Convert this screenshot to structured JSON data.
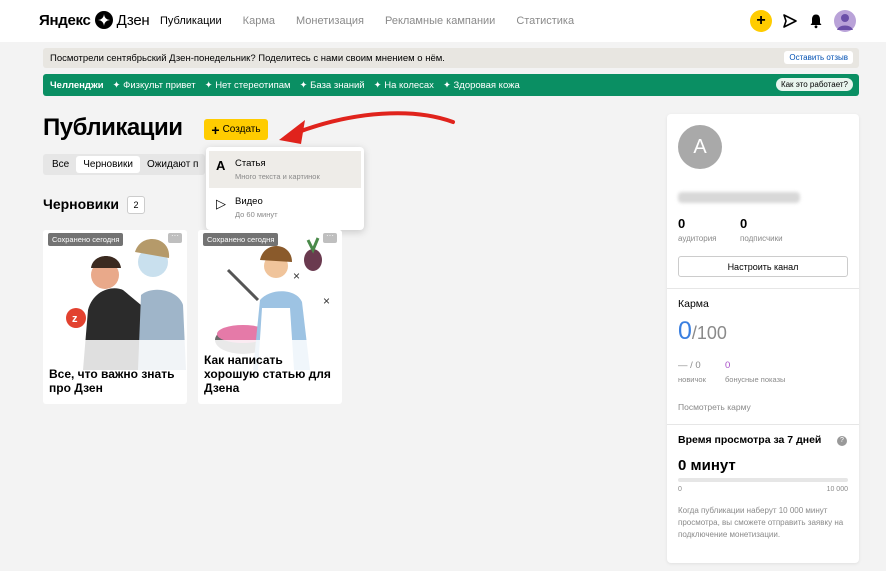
{
  "header": {
    "logo_bold": "Яндекс",
    "logo_light": "Дзен",
    "nav": [
      {
        "label": "Публикации",
        "active": true
      },
      {
        "label": "Карма",
        "active": false
      },
      {
        "label": "Монетизация",
        "active": false
      },
      {
        "label": "Рекламные кампании",
        "active": false
      },
      {
        "label": "Статистика",
        "active": false
      }
    ],
    "icons": [
      "plus-icon",
      "send-icon",
      "bell-icon",
      "avatar-icon"
    ]
  },
  "notice": {
    "text": "Посмотрели сентябрьский Дзен-понедельник? Поделитесь с нами своим мнением о нём.",
    "button": "Оставить отзыв"
  },
  "challenges": {
    "title": "Челленджи",
    "items": [
      "Физкульт привет",
      "Нет стереотипам",
      "База знаний",
      "На колесах",
      "Здоровая кожа"
    ],
    "help_button": "Как это работает?"
  },
  "main": {
    "title": "Публикации",
    "create_label": "Создать",
    "tabs": [
      {
        "label": "Все",
        "active": false
      },
      {
        "label": "Черновики",
        "active": true
      },
      {
        "label": "Ожидают п",
        "active": false
      }
    ],
    "dropdown": [
      {
        "icon": "A",
        "title": "Статья",
        "subtitle": "Много текста и картинок"
      },
      {
        "icon": "▷",
        "title": "Видео",
        "subtitle": "До 60 минут"
      }
    ],
    "drafts_title": "Черновики",
    "drafts_count": "2",
    "cards": [
      {
        "badge": "Сохранено сегодня",
        "title": "Все, что важно знать про Дзен"
      },
      {
        "badge": "Сохранено сегодня",
        "title": "Как написать хорошую статью для Дзена"
      }
    ]
  },
  "panel": {
    "avatar_letter": "A",
    "audience_value": "0",
    "audience_label": "аудитория",
    "subscribers_value": "0",
    "subscribers_label": "подписчики",
    "setup_button": "Настроить канал",
    "karma_title": "Карма",
    "karma_value": "0",
    "karma_max": "/100",
    "newbie_value": "— / 0",
    "newbie_label": "новичок",
    "bonus_value": "0",
    "bonus_label": "бонусные показы",
    "karma_link": "Посмотреть карму",
    "time_title": "Время просмотра за 7 дней",
    "time_value": "0 минут",
    "progress_fraction": 0,
    "progress_min": "0",
    "progress_max": "10 000",
    "time_note": "Когда публикации наберут 10 000 минут просмотра, вы сможете отправить заявку на подключение монетизации."
  },
  "colors": {
    "accent_yellow": "#ffcc00",
    "challenge_green": "#0a8f63",
    "karma_blue": "#3a7fe0",
    "arrow_red": "#e0231c"
  }
}
